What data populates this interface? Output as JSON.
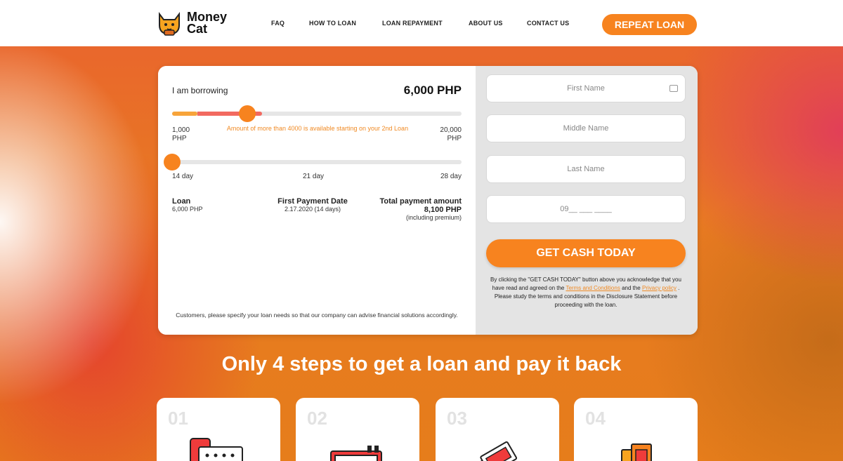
{
  "brand": {
    "name_line1": "Money",
    "name_line2": "Cat"
  },
  "nav": {
    "faq": "FAQ",
    "how_to_loan": "HOW TO LOAN",
    "loan_repayment": "LOAN REPAYMENT",
    "about_us": "ABOUT US",
    "contact_us": "CONTACT US",
    "repeat_loan": "REPEAT LOAN"
  },
  "calculator": {
    "borrow_label": "I am borrowing",
    "borrow_amount": "6,000 PHP",
    "amount_slider": {
      "min": "1,000",
      "min_unit": "PHP",
      "max": "20,000",
      "max_unit": "PHP",
      "value": 6000
    },
    "availability_note": "Amount of more than 4000 is available starting on your 2nd Loan",
    "term_slider": {
      "min": "14 day",
      "mid": "21 day",
      "max": "28 day",
      "value": 14
    },
    "summary": {
      "loan_label": "Loan",
      "loan_value": "6,000 PHP",
      "first_payment_label": "First Payment Date",
      "first_payment_value": "2.17.2020 (14 days)",
      "total_label": "Total payment amount",
      "total_value": "8,100 PHP",
      "total_note": "(including premium)"
    },
    "footnote": "Customers, please specify your loan needs so that our company can advise financial solutions accordingly."
  },
  "form": {
    "first_name_placeholder": "First Name",
    "middle_name_placeholder": "Middle Name",
    "last_name_placeholder": "Last Name",
    "phone_placeholder": "09__ ___ ____",
    "submit_label": "GET CASH TODAY",
    "disclaimer_part1": "By clicking the \"GET CASH TODAY\" button above you acknowledge that you have read and agreed on the",
    "terms_link": "Terms and Conditions",
    "and_text": "and the",
    "privacy_link": "Privacy policy",
    "disclaimer_period": ".",
    "disclaimer_part2": "Please study the terms and conditions in the Disclosure Statement before proceeding with the loan."
  },
  "steps": {
    "title": "Only 4 steps to get a loan and pay it back",
    "items": [
      {
        "number": "01",
        "icon": "phone-form-icon"
      },
      {
        "number": "02",
        "icon": "document-icon"
      },
      {
        "number": "03",
        "icon": "cash-stack-icon"
      },
      {
        "number": "04",
        "icon": "money-bills-icon"
      }
    ]
  },
  "colors": {
    "accent": "#f7831f",
    "accent_light": "#f08a24"
  }
}
